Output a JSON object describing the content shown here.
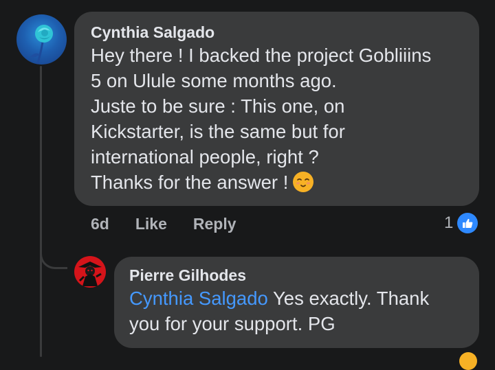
{
  "comment": {
    "author": "Cynthia Salgado",
    "text_lines": [
      "Hey there ! I backed the project Gobliiins",
      "5 on Ulule some months ago.",
      "Juste to be sure : This one, on",
      "Kickstarter, is the same but for",
      "international people, right ?",
      "Thanks for the answer !"
    ],
    "emoji": "smiling-face-with-smiling-eyes",
    "time": "6d",
    "like_label": "Like",
    "reply_label": "Reply",
    "reaction_count": "1",
    "reaction_type": "like-icon"
  },
  "reply": {
    "author": "Pierre Gilhodes",
    "mention": "Cynthia Salgado",
    "text_line1": " Yes exactly. Thank",
    "text_line2": "you for your support.   PG"
  },
  "colors": {
    "background": "#18191a",
    "bubble": "#3a3b3c",
    "text": "#e4e6eb",
    "secondary_text": "#b0b3b8",
    "mention": "#4599ff",
    "like_blue": "#2e89ff"
  }
}
